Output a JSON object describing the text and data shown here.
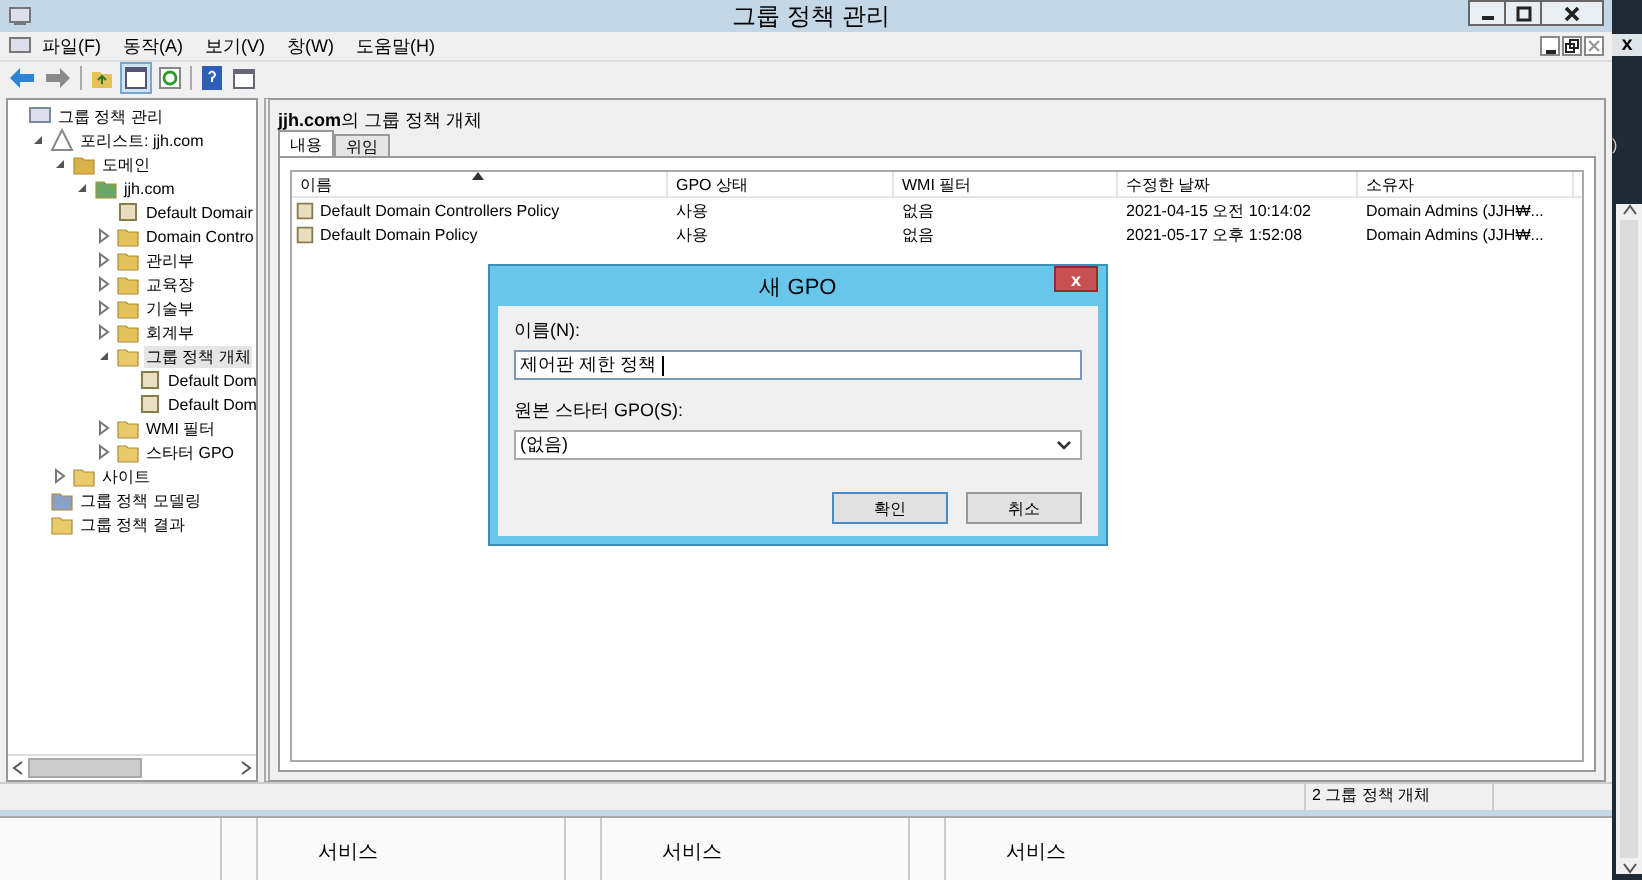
{
  "window": {
    "title": "그룹 정책 관리"
  },
  "menu": [
    "파일(F)",
    "동작(A)",
    "보기(V)",
    "창(W)",
    "도움말(H)"
  ],
  "tree": [
    {
      "label": "그룹 정책 관리",
      "kind": "console",
      "expandable": false,
      "selected": false,
      "children": [
        {
          "label": "포리스트: jjh.com",
          "kind": "forest",
          "expandable": true,
          "expanded": true,
          "selected": false,
          "children": [
            {
              "label": "도메인",
              "kind": "domains",
              "expandable": true,
              "expanded": true,
              "selected": false,
              "children": [
                {
                  "label": "jjh.com",
                  "kind": "domain",
                  "expandable": true,
                  "expanded": true,
                  "selected": false,
                  "children": [
                    {
                      "label": "Default Domair",
                      "kind": "gpo",
                      "expandable": false,
                      "selected": false
                    },
                    {
                      "label": "Domain Contro",
                      "kind": "ou",
                      "expandable": true,
                      "expanded": false,
                      "selected": false
                    },
                    {
                      "label": "관리부",
                      "kind": "ou",
                      "expandable": true,
                      "expanded": false,
                      "selected": false
                    },
                    {
                      "label": "교육장",
                      "kind": "ou",
                      "expandable": true,
                      "expanded": false,
                      "selected": false
                    },
                    {
                      "label": "기술부",
                      "kind": "ou",
                      "expandable": true,
                      "expanded": false,
                      "selected": false
                    },
                    {
                      "label": "회계부",
                      "kind": "ou",
                      "expandable": true,
                      "expanded": false,
                      "selected": false
                    },
                    {
                      "label": "그룹 정책 개체",
                      "kind": "folder",
                      "expandable": true,
                      "expanded": true,
                      "selected": true,
                      "children": [
                        {
                          "label": "Default Dom",
                          "kind": "gpo",
                          "expandable": false,
                          "selected": false
                        },
                        {
                          "label": "Default Dom",
                          "kind": "gpo",
                          "expandable": false,
                          "selected": false
                        }
                      ]
                    },
                    {
                      "label": "WMI 필터",
                      "kind": "folder",
                      "expandable": true,
                      "expanded": false,
                      "selected": false
                    },
                    {
                      "label": "스타터 GPO",
                      "kind": "folder",
                      "expandable": true,
                      "expanded": false,
                      "selected": false
                    }
                  ]
                }
              ]
            },
            {
              "label": "사이트",
              "kind": "folder",
              "expandable": true,
              "expanded": false,
              "selected": false
            }
          ]
        },
        {
          "label": "그룹 정책 모델링",
          "kind": "modeling",
          "expandable": false,
          "selected": false
        },
        {
          "label": "그룹 정책 결과",
          "kind": "folder",
          "expandable": false,
          "selected": false
        }
      ]
    }
  ],
  "panel": {
    "heading": "**jjh.com**의 그룹 정책 개체"
  },
  "tabs": [
    {
      "label": "내용",
      "selected": true
    },
    {
      "label": "위임",
      "selected": false
    }
  ],
  "table": {
    "columns": [
      "이름",
      "GPO 상태",
      "WMI 필터",
      "수정한 날짜",
      "소유자"
    ],
    "rows": [
      [
        "Default Domain Controllers Policy",
        "사용",
        "없음",
        "2021-04-15 오전 10:14:02",
        "Domain Admins (JJH₩..."
      ],
      [
        "Default Domain Policy",
        "사용",
        "없음",
        "2021-05-17 오후 1:52:08",
        "Domain Admins (JJH₩..."
      ]
    ]
  },
  "status_bar": "2 그룹 정책 개체",
  "dialog": {
    "title": "새 GPO",
    "close": "x",
    "name_label": "이름(N):",
    "name_value": "제어판 제한 정책 ",
    "starter_label": "원본 스타터 GPO(S):",
    "starter_value": "(없음)",
    "buttons": [
      "확인",
      "취소"
    ]
  },
  "background": {
    "close": "x",
    "fragment": ")",
    "columns": [
      "서비스",
      "서비스",
      "서비스"
    ]
  }
}
